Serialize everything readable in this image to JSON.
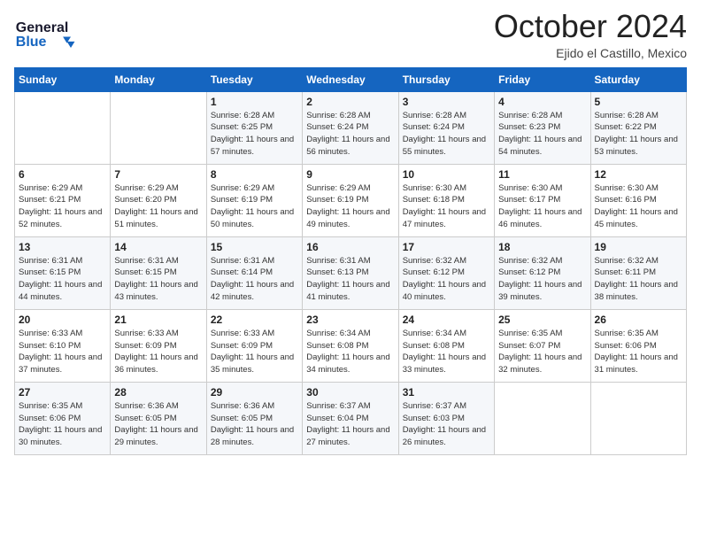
{
  "logo": {
    "line1": "General",
    "line2": "Blue"
  },
  "title": "October 2024",
  "location": "Ejido el Castillo, Mexico",
  "days_of_week": [
    "Sunday",
    "Monday",
    "Tuesday",
    "Wednesday",
    "Thursday",
    "Friday",
    "Saturday"
  ],
  "weeks": [
    [
      {
        "day": "",
        "detail": ""
      },
      {
        "day": "",
        "detail": ""
      },
      {
        "day": "1",
        "detail": "Sunrise: 6:28 AM\nSunset: 6:25 PM\nDaylight: 11 hours and 57 minutes."
      },
      {
        "day": "2",
        "detail": "Sunrise: 6:28 AM\nSunset: 6:24 PM\nDaylight: 11 hours and 56 minutes."
      },
      {
        "day": "3",
        "detail": "Sunrise: 6:28 AM\nSunset: 6:24 PM\nDaylight: 11 hours and 55 minutes."
      },
      {
        "day": "4",
        "detail": "Sunrise: 6:28 AM\nSunset: 6:23 PM\nDaylight: 11 hours and 54 minutes."
      },
      {
        "day": "5",
        "detail": "Sunrise: 6:28 AM\nSunset: 6:22 PM\nDaylight: 11 hours and 53 minutes."
      }
    ],
    [
      {
        "day": "6",
        "detail": "Sunrise: 6:29 AM\nSunset: 6:21 PM\nDaylight: 11 hours and 52 minutes."
      },
      {
        "day": "7",
        "detail": "Sunrise: 6:29 AM\nSunset: 6:20 PM\nDaylight: 11 hours and 51 minutes."
      },
      {
        "day": "8",
        "detail": "Sunrise: 6:29 AM\nSunset: 6:19 PM\nDaylight: 11 hours and 50 minutes."
      },
      {
        "day": "9",
        "detail": "Sunrise: 6:29 AM\nSunset: 6:19 PM\nDaylight: 11 hours and 49 minutes."
      },
      {
        "day": "10",
        "detail": "Sunrise: 6:30 AM\nSunset: 6:18 PM\nDaylight: 11 hours and 47 minutes."
      },
      {
        "day": "11",
        "detail": "Sunrise: 6:30 AM\nSunset: 6:17 PM\nDaylight: 11 hours and 46 minutes."
      },
      {
        "day": "12",
        "detail": "Sunrise: 6:30 AM\nSunset: 6:16 PM\nDaylight: 11 hours and 45 minutes."
      }
    ],
    [
      {
        "day": "13",
        "detail": "Sunrise: 6:31 AM\nSunset: 6:15 PM\nDaylight: 11 hours and 44 minutes."
      },
      {
        "day": "14",
        "detail": "Sunrise: 6:31 AM\nSunset: 6:15 PM\nDaylight: 11 hours and 43 minutes."
      },
      {
        "day": "15",
        "detail": "Sunrise: 6:31 AM\nSunset: 6:14 PM\nDaylight: 11 hours and 42 minutes."
      },
      {
        "day": "16",
        "detail": "Sunrise: 6:31 AM\nSunset: 6:13 PM\nDaylight: 11 hours and 41 minutes."
      },
      {
        "day": "17",
        "detail": "Sunrise: 6:32 AM\nSunset: 6:12 PM\nDaylight: 11 hours and 40 minutes."
      },
      {
        "day": "18",
        "detail": "Sunrise: 6:32 AM\nSunset: 6:12 PM\nDaylight: 11 hours and 39 minutes."
      },
      {
        "day": "19",
        "detail": "Sunrise: 6:32 AM\nSunset: 6:11 PM\nDaylight: 11 hours and 38 minutes."
      }
    ],
    [
      {
        "day": "20",
        "detail": "Sunrise: 6:33 AM\nSunset: 6:10 PM\nDaylight: 11 hours and 37 minutes."
      },
      {
        "day": "21",
        "detail": "Sunrise: 6:33 AM\nSunset: 6:09 PM\nDaylight: 11 hours and 36 minutes."
      },
      {
        "day": "22",
        "detail": "Sunrise: 6:33 AM\nSunset: 6:09 PM\nDaylight: 11 hours and 35 minutes."
      },
      {
        "day": "23",
        "detail": "Sunrise: 6:34 AM\nSunset: 6:08 PM\nDaylight: 11 hours and 34 minutes."
      },
      {
        "day": "24",
        "detail": "Sunrise: 6:34 AM\nSunset: 6:08 PM\nDaylight: 11 hours and 33 minutes."
      },
      {
        "day": "25",
        "detail": "Sunrise: 6:35 AM\nSunset: 6:07 PM\nDaylight: 11 hours and 32 minutes."
      },
      {
        "day": "26",
        "detail": "Sunrise: 6:35 AM\nSunset: 6:06 PM\nDaylight: 11 hours and 31 minutes."
      }
    ],
    [
      {
        "day": "27",
        "detail": "Sunrise: 6:35 AM\nSunset: 6:06 PM\nDaylight: 11 hours and 30 minutes."
      },
      {
        "day": "28",
        "detail": "Sunrise: 6:36 AM\nSunset: 6:05 PM\nDaylight: 11 hours and 29 minutes."
      },
      {
        "day": "29",
        "detail": "Sunrise: 6:36 AM\nSunset: 6:05 PM\nDaylight: 11 hours and 28 minutes."
      },
      {
        "day": "30",
        "detail": "Sunrise: 6:37 AM\nSunset: 6:04 PM\nDaylight: 11 hours and 27 minutes."
      },
      {
        "day": "31",
        "detail": "Sunrise: 6:37 AM\nSunset: 6:03 PM\nDaylight: 11 hours and 26 minutes."
      },
      {
        "day": "",
        "detail": ""
      },
      {
        "day": "",
        "detail": ""
      }
    ]
  ]
}
